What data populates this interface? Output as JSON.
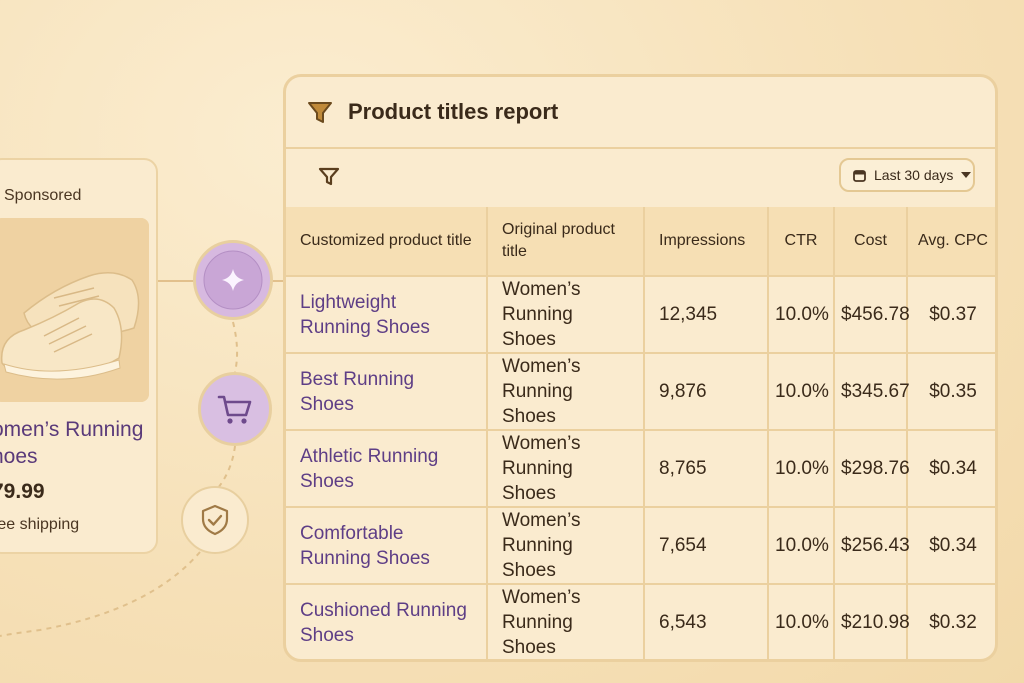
{
  "ad": {
    "sponsored": "Sponsored",
    "title": "Women’s Running Shoes",
    "title_visible": "omen’s Running",
    "title_visible_2": "hoes",
    "price_visible": "79.99",
    "shipping_visible": "ree shipping",
    "image": "running-shoes-product-image"
  },
  "features": {
    "icons": [
      "sparkle-icon",
      "cart-icon",
      "shield-check-icon"
    ]
  },
  "report": {
    "title": "Product titles report",
    "date_range": "Last 30 days",
    "columns": [
      "Customized product title",
      "Original product title",
      "Impressions",
      "CTR",
      "Cost",
      "Avg. CPC"
    ],
    "rows": [
      {
        "custom": "Lightweight Running Shoes",
        "original": "Women’s Running Shoes",
        "impressions": "12,345",
        "ctr": "10.0%",
        "cost": "$456.78",
        "cpc": "$0.37"
      },
      {
        "custom": "Best Running Shoes",
        "original": "Women’s Running Shoes",
        "impressions": "9,876",
        "ctr": "10.0%",
        "cost": "$345.67",
        "cpc": "$0.35"
      },
      {
        "custom": "Athletic Running Shoes",
        "original": "Women’s Running Shoes",
        "impressions": "8,765",
        "ctr": "10.0%",
        "cost": "$298.76",
        "cpc": "$0.34"
      },
      {
        "custom": "Comfortable Running Shoes",
        "original": "Women’s Running Shoes",
        "impressions": "7,654",
        "ctr": "10.0%",
        "cost": "$256.43",
        "cpc": "$0.34"
      },
      {
        "custom": "Cushioned Running Shoes",
        "original": "Women’s Running Shoes",
        "impressions": "6,543",
        "ctr": "10.0%",
        "cost": "$210.98",
        "cpc": "$0.32"
      }
    ]
  },
  "colors": {
    "background": "#f7e3bd",
    "accent_purple": "#5e3e86",
    "icon_circle": "#d7b9e0",
    "border": "#ebd09f"
  }
}
